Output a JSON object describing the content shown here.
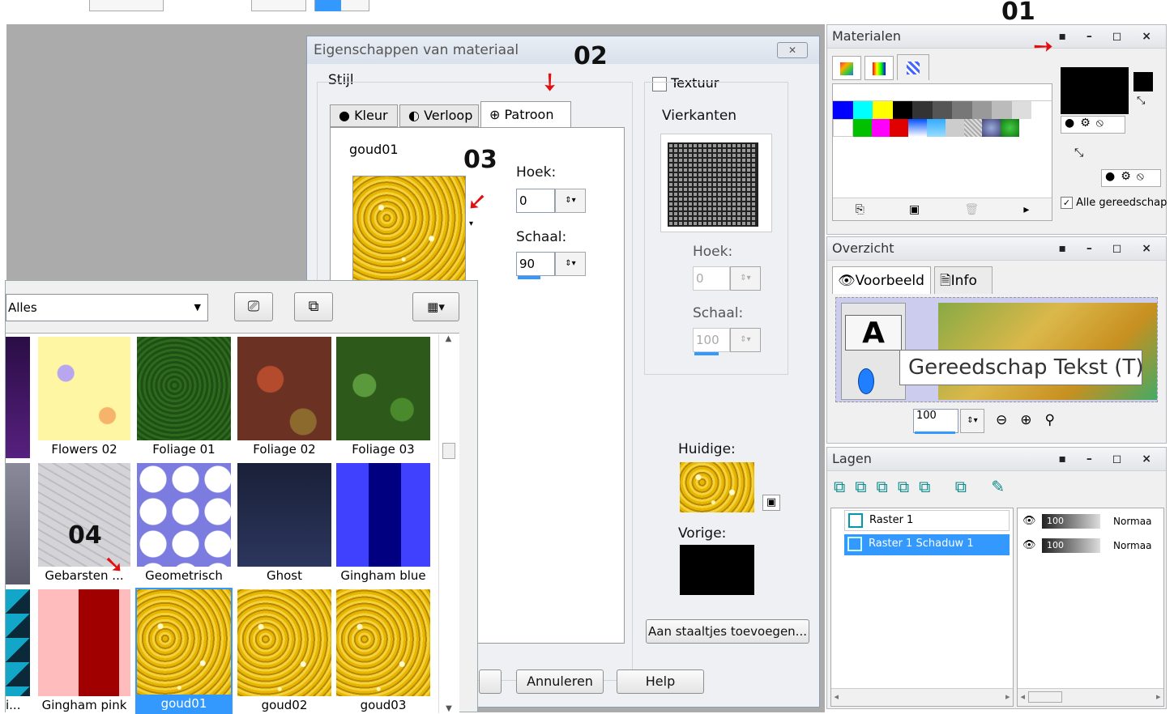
{
  "materials": {
    "title": "Materialen",
    "all_tools_label": "Alle gereedschap",
    "badge": "01"
  },
  "overview": {
    "title": "Overzicht",
    "tabs": [
      {
        "label": "Voorbeeld"
      },
      {
        "label": "Info"
      }
    ],
    "tooltip": "Gereedschap Tekst (T)",
    "zoom_value": "100",
    "preview_letter": "A"
  },
  "layers": {
    "title": "Lagen",
    "rows": [
      {
        "name": "Raster 1",
        "opacity": "100",
        "blend": "Normaa"
      },
      {
        "name": "Raster 1 Schaduw 1",
        "opacity": "100",
        "blend": "Normaa"
      }
    ]
  },
  "dialog": {
    "title": "Eigenschappen van materiaal",
    "style_label": "Stijl",
    "tabs": [
      {
        "label": "Kleur"
      },
      {
        "label": "Verloop"
      },
      {
        "label": "Patroon"
      }
    ],
    "pattern_name": "goud01",
    "angle_label": "Hoek:",
    "angle_value": "0",
    "scale_label": "Schaal:",
    "scale_value": "90",
    "texture_label": "Textuur",
    "texture_name": "Vierkanten",
    "texture_angle_label": "Hoek:",
    "texture_angle_value": "0",
    "texture_scale_label": "Schaal:",
    "texture_scale_value": "100",
    "current_label": "Huidige:",
    "previous_label": "Vorige:",
    "add_swatch_button": "Aan staaltjes toevoegen...",
    "cancel_button": "Annuleren",
    "help_button": "Help",
    "badge_02": "02",
    "badge_03": "03"
  },
  "picker": {
    "filter": "Alles",
    "badge_04": "04",
    "swatches": [
      {
        "label": "Flowers 02"
      },
      {
        "label": "Foliage 01"
      },
      {
        "label": "Foliage 02"
      },
      {
        "label": "Foliage 03"
      },
      {
        "label": "Gebarsten ..."
      },
      {
        "label": "Geometrisch"
      },
      {
        "label": "Ghost"
      },
      {
        "label": "Gingham blue"
      },
      {
        "label": "i..."
      },
      {
        "label": "Gingham pink"
      },
      {
        "label": "goud01"
      },
      {
        "label": "goud02"
      },
      {
        "label": "goud03"
      }
    ]
  },
  "colors": {
    "accent": "#3399ff",
    "arrow": "#e01010",
    "highlight": "#3399ff"
  }
}
